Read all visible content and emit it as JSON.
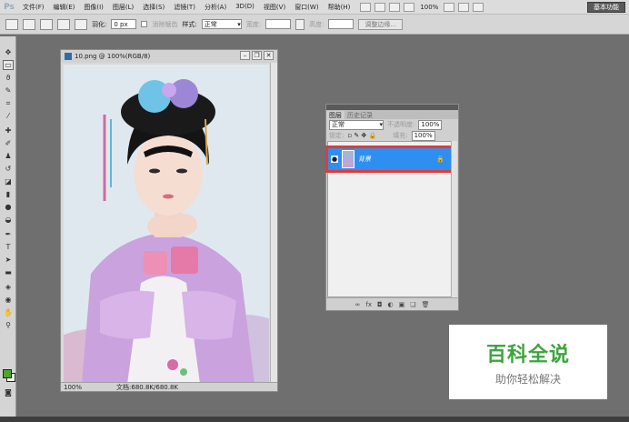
{
  "app": {
    "logo": "Ps",
    "workspace_button": "基本功能"
  },
  "menubar": {
    "items": [
      "文件(F)",
      "编辑(E)",
      "图像(I)",
      "图层(L)",
      "选择(S)",
      "滤镜(T)",
      "分析(A)",
      "3D(D)",
      "视图(V)",
      "窗口(W)",
      "帮助(H)"
    ],
    "zoom": "100%"
  },
  "options": {
    "feather_label": "羽化:",
    "feather_value": "0 px",
    "antialias_label": "消除锯齿",
    "style_label": "样式:",
    "style_value": "正常",
    "width_label": "宽度:",
    "height_label": "高度:",
    "refine_edge": "调整边缘..."
  },
  "document": {
    "title": "10.png @ 100%(RGB/8)",
    "zoom": "100%",
    "doc_info": "文档:680.8K/680.8K"
  },
  "layers_panel": {
    "tabs": [
      "图层",
      "历史记录"
    ],
    "blend_mode": "正常",
    "opacity_label": "不透明度:",
    "opacity_value": "100%",
    "lock_label": "锁定:",
    "fill_label": "填充:",
    "fill_value": "100%",
    "layer_name": "背景"
  },
  "watermark": {
    "main": "百科全说",
    "sub": "助你轻松解决"
  },
  "colors": {
    "foreground": "#4aa82d",
    "background": "#ffffff",
    "layer_selected": "#2f8ff0",
    "highlight_box": "#e53935"
  }
}
